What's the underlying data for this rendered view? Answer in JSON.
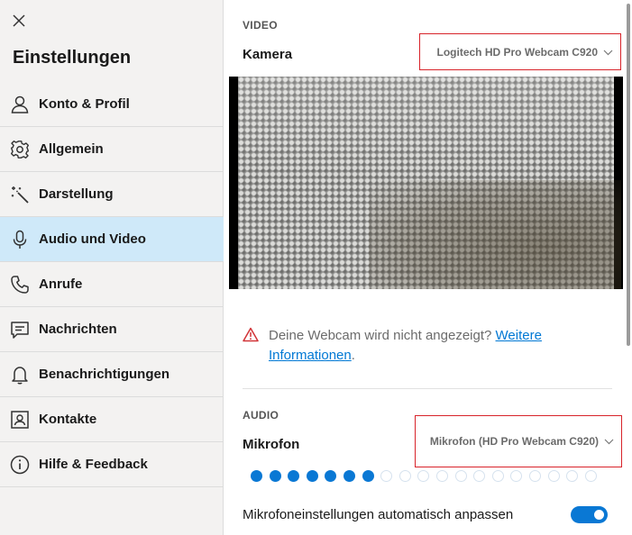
{
  "sidebar": {
    "title": "Einstellungen",
    "close_icon": "close-icon",
    "items": [
      {
        "label": "Konto & Profil",
        "icon": "person-icon",
        "active": false
      },
      {
        "label": "Allgemein",
        "icon": "gear-icon",
        "active": false
      },
      {
        "label": "Darstellung",
        "icon": "magic-wand-icon",
        "active": false
      },
      {
        "label": "Audio und Video",
        "icon": "microphone-icon",
        "active": true
      },
      {
        "label": "Anrufe",
        "icon": "phone-icon",
        "active": false
      },
      {
        "label": "Nachrichten",
        "icon": "message-icon",
        "active": false
      },
      {
        "label": "Benachrichtigungen",
        "icon": "bell-icon",
        "active": false
      },
      {
        "label": "Kontakte",
        "icon": "contact-card-icon",
        "active": false
      },
      {
        "label": "Hilfe & Feedback",
        "icon": "info-icon",
        "active": false
      }
    ]
  },
  "video": {
    "section_label": "VIDEO",
    "camera_label": "Kamera",
    "camera_value": "Logitech HD Pro Webcam C920",
    "warning_text": "Deine Webcam wird nicht angezeigt? ",
    "warning_link": "Weitere Informationen",
    "warning_end": "."
  },
  "audio": {
    "section_label": "AUDIO",
    "mic_label": "Mikrofon",
    "mic_value": "Mikrofon (HD Pro Webcam C920)",
    "level_active_dots": 7,
    "level_total_dots": 19,
    "auto_adjust_label": "Mikrofoneinstellungen automatisch anpassen",
    "auto_adjust_on": true
  },
  "colors": {
    "accent": "#0a78d4",
    "active_nav": "#cfe9f9",
    "highlight_border": "#d8232a",
    "warning": "#d13438"
  }
}
